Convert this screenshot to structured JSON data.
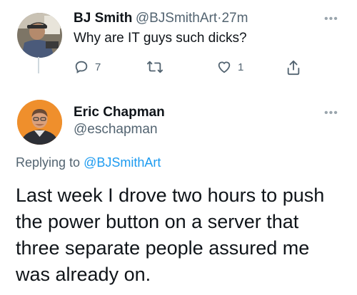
{
  "tweet1": {
    "name": "BJ Smith",
    "handle": "@BJSmithArt",
    "separator": "·",
    "time": "27m",
    "text": "Why are IT guys such dicks?",
    "reply_count": "7",
    "retweet_count": "",
    "like_count": "1"
  },
  "tweet2": {
    "name": "Eric Chapman",
    "handle": "@eschapman",
    "replying_prefix": "Replying to",
    "replying_handle": "@BJSmithArt",
    "text_lines": [
      "Last week I drove two hours to push",
      "the power button on a server that",
      "three separate people assured me",
      "was already on."
    ]
  },
  "icons": {
    "more": "more-icon",
    "reply": "reply-icon",
    "retweet": "retweet-icon",
    "like": "like-icon",
    "share": "share-icon"
  },
  "colors": {
    "text": "#0f1419",
    "secondary": "#536471",
    "link": "#1d9bf0",
    "divider": "#cfd9de"
  }
}
